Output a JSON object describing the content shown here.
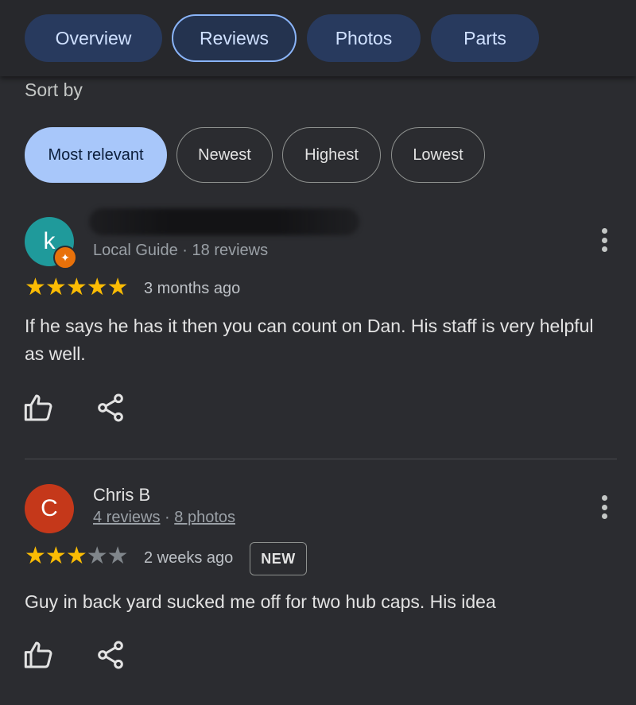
{
  "tabs": [
    {
      "label": "Overview"
    },
    {
      "label": "Reviews"
    },
    {
      "label": "Photos"
    },
    {
      "label": "Parts"
    }
  ],
  "sort": {
    "label": "Sort by",
    "options": [
      "Most relevant",
      "Newest",
      "Highest",
      "Lowest"
    ],
    "selected": "Most relevant"
  },
  "reviews": [
    {
      "avatar_letter": "k",
      "avatar_color": "#1f9a9b",
      "subline": "Local Guide · 18 reviews",
      "rating": 5,
      "date": "3 months ago",
      "text": "If he says he has it then you can count on Dan. His staff is very helpful  as well."
    },
    {
      "avatar_letter": "C",
      "avatar_color": "#c5381a",
      "name": "Chris B",
      "subline_reviews": "4 reviews",
      "subline_sep": " · ",
      "subline_photos": "8 photos",
      "rating": 3,
      "date": "2 weeks ago",
      "badge": "NEW",
      "text": "Guy in back yard sucked me off for two hub caps. His idea"
    }
  ],
  "icons": {
    "like": "thumbs-up-icon",
    "share": "share-icon",
    "more": "more-vert-icon",
    "local_guide": "local-guide-badge-icon"
  }
}
